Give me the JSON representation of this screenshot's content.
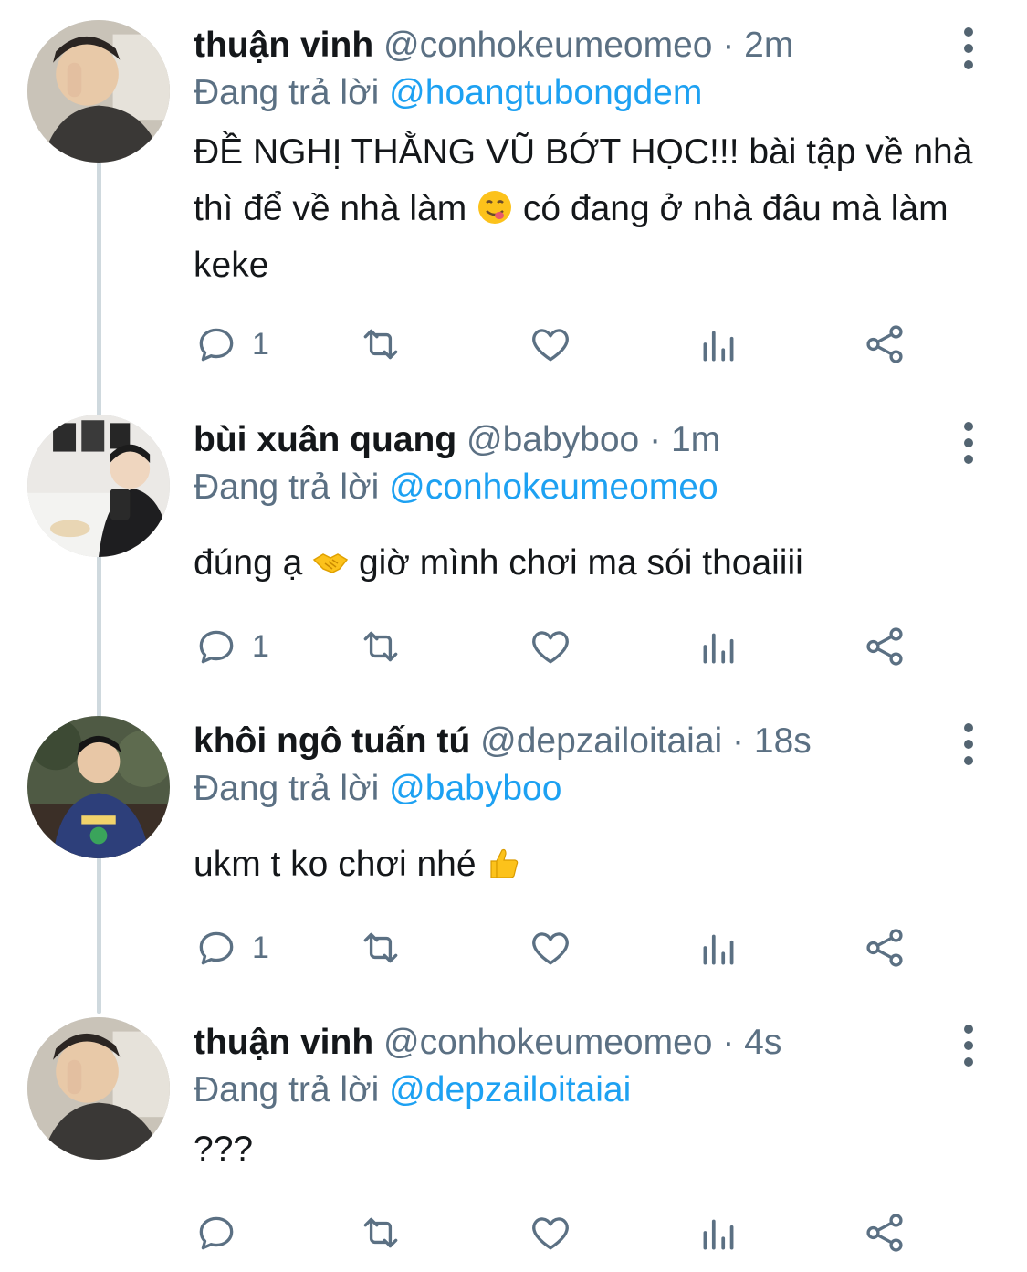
{
  "colors": {
    "text": "#14171a",
    "muted": "#5b7083",
    "accent": "#1da1f2",
    "line": "#cfd9de"
  },
  "tweets": [
    {
      "name": "thuận vinh",
      "handle": "@conhokeumeomeo",
      "separator": "·",
      "time": "2m",
      "reply_prefix": "Đang trả lời",
      "reply_to": "@hoangtubongdem",
      "text_before_emoji": "ĐỀ NGHỊ THẰNG VŨ BỚT HỌC!!! bài tập về nhà thì để về nhà làm ",
      "emoji": "face-savoring-food-icon",
      "text_after_emoji": " có đang ở nhà đâu mà làm keke",
      "reply_count": "1"
    },
    {
      "name": "bùi xuân quang",
      "handle": "@babyboo",
      "separator": "·",
      "time": "1m",
      "reply_prefix": "Đang trả lời",
      "reply_to": "@conhokeumeomeo",
      "text_before_emoji": "đúng ạ ",
      "emoji": "handshake-icon",
      "text_after_emoji": " giờ mình chơi ma sói thoaiiii",
      "reply_count": "1"
    },
    {
      "name": "khôi ngô tuấn tú",
      "handle": "@depzailoitaiai",
      "separator": "·",
      "time": "18s",
      "reply_prefix": "Đang trả lời",
      "reply_to": "@babyboo",
      "text_before_emoji": "ukm t ko chơi nhé ",
      "emoji": "thumbs-up-icon",
      "text_after_emoji": "",
      "reply_count": "1"
    },
    {
      "name": "thuận vinh",
      "handle": "@conhokeumeomeo",
      "separator": "·",
      "time": "4s",
      "reply_prefix": "Đang trả lời",
      "reply_to": "@depzailoitaiai",
      "text_before_emoji": "???",
      "emoji": "",
      "text_after_emoji": "",
      "reply_count": ""
    }
  ]
}
